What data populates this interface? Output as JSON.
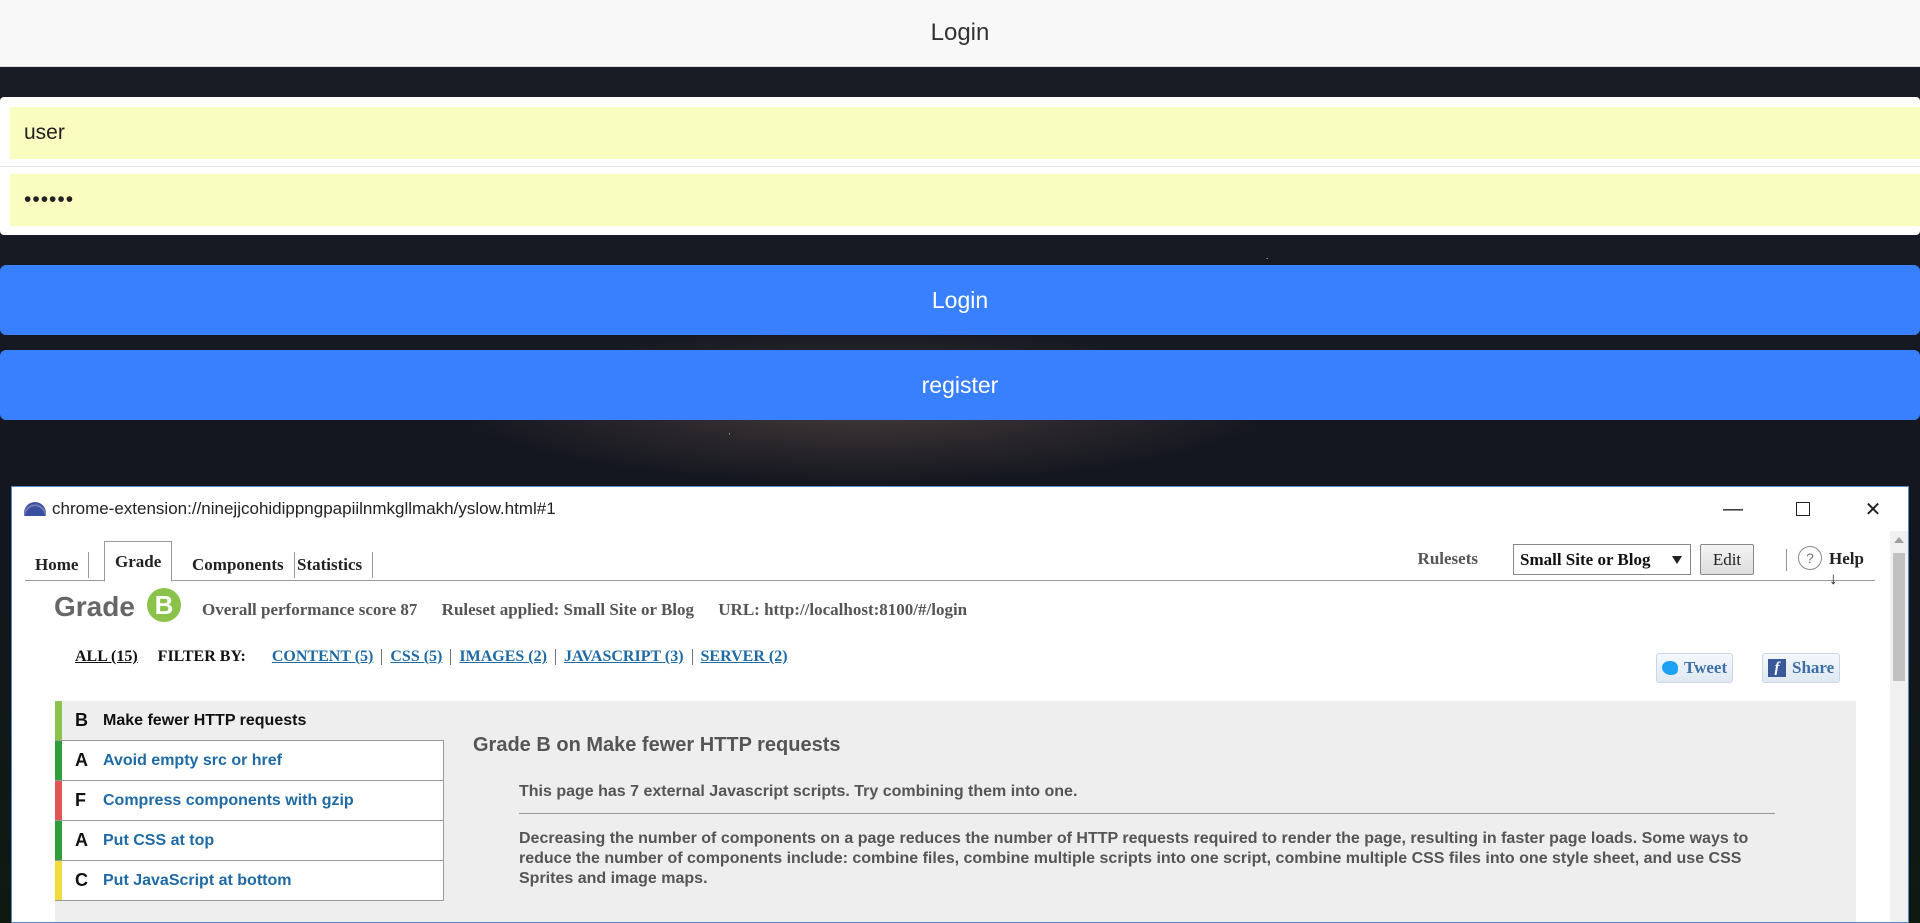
{
  "app": {
    "title": "Login",
    "username_value": "user",
    "password_value": "••••••",
    "login_label": "Login",
    "register_label": "register"
  },
  "window": {
    "url": "chrome-extension://ninejjcohidippngpapiilnmkgllmakh/yslow.html#1",
    "minimize": "—",
    "close": "✕"
  },
  "tabs": [
    {
      "label": "Home"
    },
    {
      "label": "Grade"
    },
    {
      "label": "Components"
    },
    {
      "label": "Statistics"
    }
  ],
  "toolbar": {
    "rulesets_label": "Rulesets",
    "ruleset_value": "Small Site or Blog",
    "edit_label": "Edit",
    "help_icon": "?",
    "help_label": "Help ↓"
  },
  "grade": {
    "title": "Grade",
    "letter": "B",
    "score_text": "Overall performance score 87",
    "ruleset_text": "Ruleset applied: Small Site or Blog",
    "url_text": "URL: http://localhost:8100/#/login"
  },
  "filters": {
    "all": "ALL (15)",
    "filter_by": "FILTER BY:",
    "links": [
      "CONTENT (5)",
      "CSS (5)",
      "IMAGES (2)",
      "JAVASCRIPT (3)",
      "SERVER (2)"
    ],
    "tweet": "Tweet",
    "share": "Share"
  },
  "rules": [
    {
      "grade": "B",
      "label": "Make fewer HTTP requests",
      "color": "#8bc34a"
    },
    {
      "grade": "A",
      "label": "Avoid empty src or href",
      "color": "#2e9e3c"
    },
    {
      "grade": "F",
      "label": "Compress components with gzip",
      "color": "#e05555"
    },
    {
      "grade": "A",
      "label": "Put CSS at top",
      "color": "#2e9e3c"
    },
    {
      "grade": "C",
      "label": "Put JavaScript at bottom",
      "color": "#f2dc3c"
    }
  ],
  "detail": {
    "title": "Grade B on Make fewer HTTP requests",
    "message": "This page has 7 external Javascript scripts. Try combining them into one.",
    "body": "Decreasing the number of components on a page reduces the number of HTTP requests required to render the page, resulting in faster page loads. Some ways to reduce the number of components include: combine files, combine multiple scripts into one script, combine multiple CSS files into one style sheet, and use CSS Sprites and image maps."
  }
}
